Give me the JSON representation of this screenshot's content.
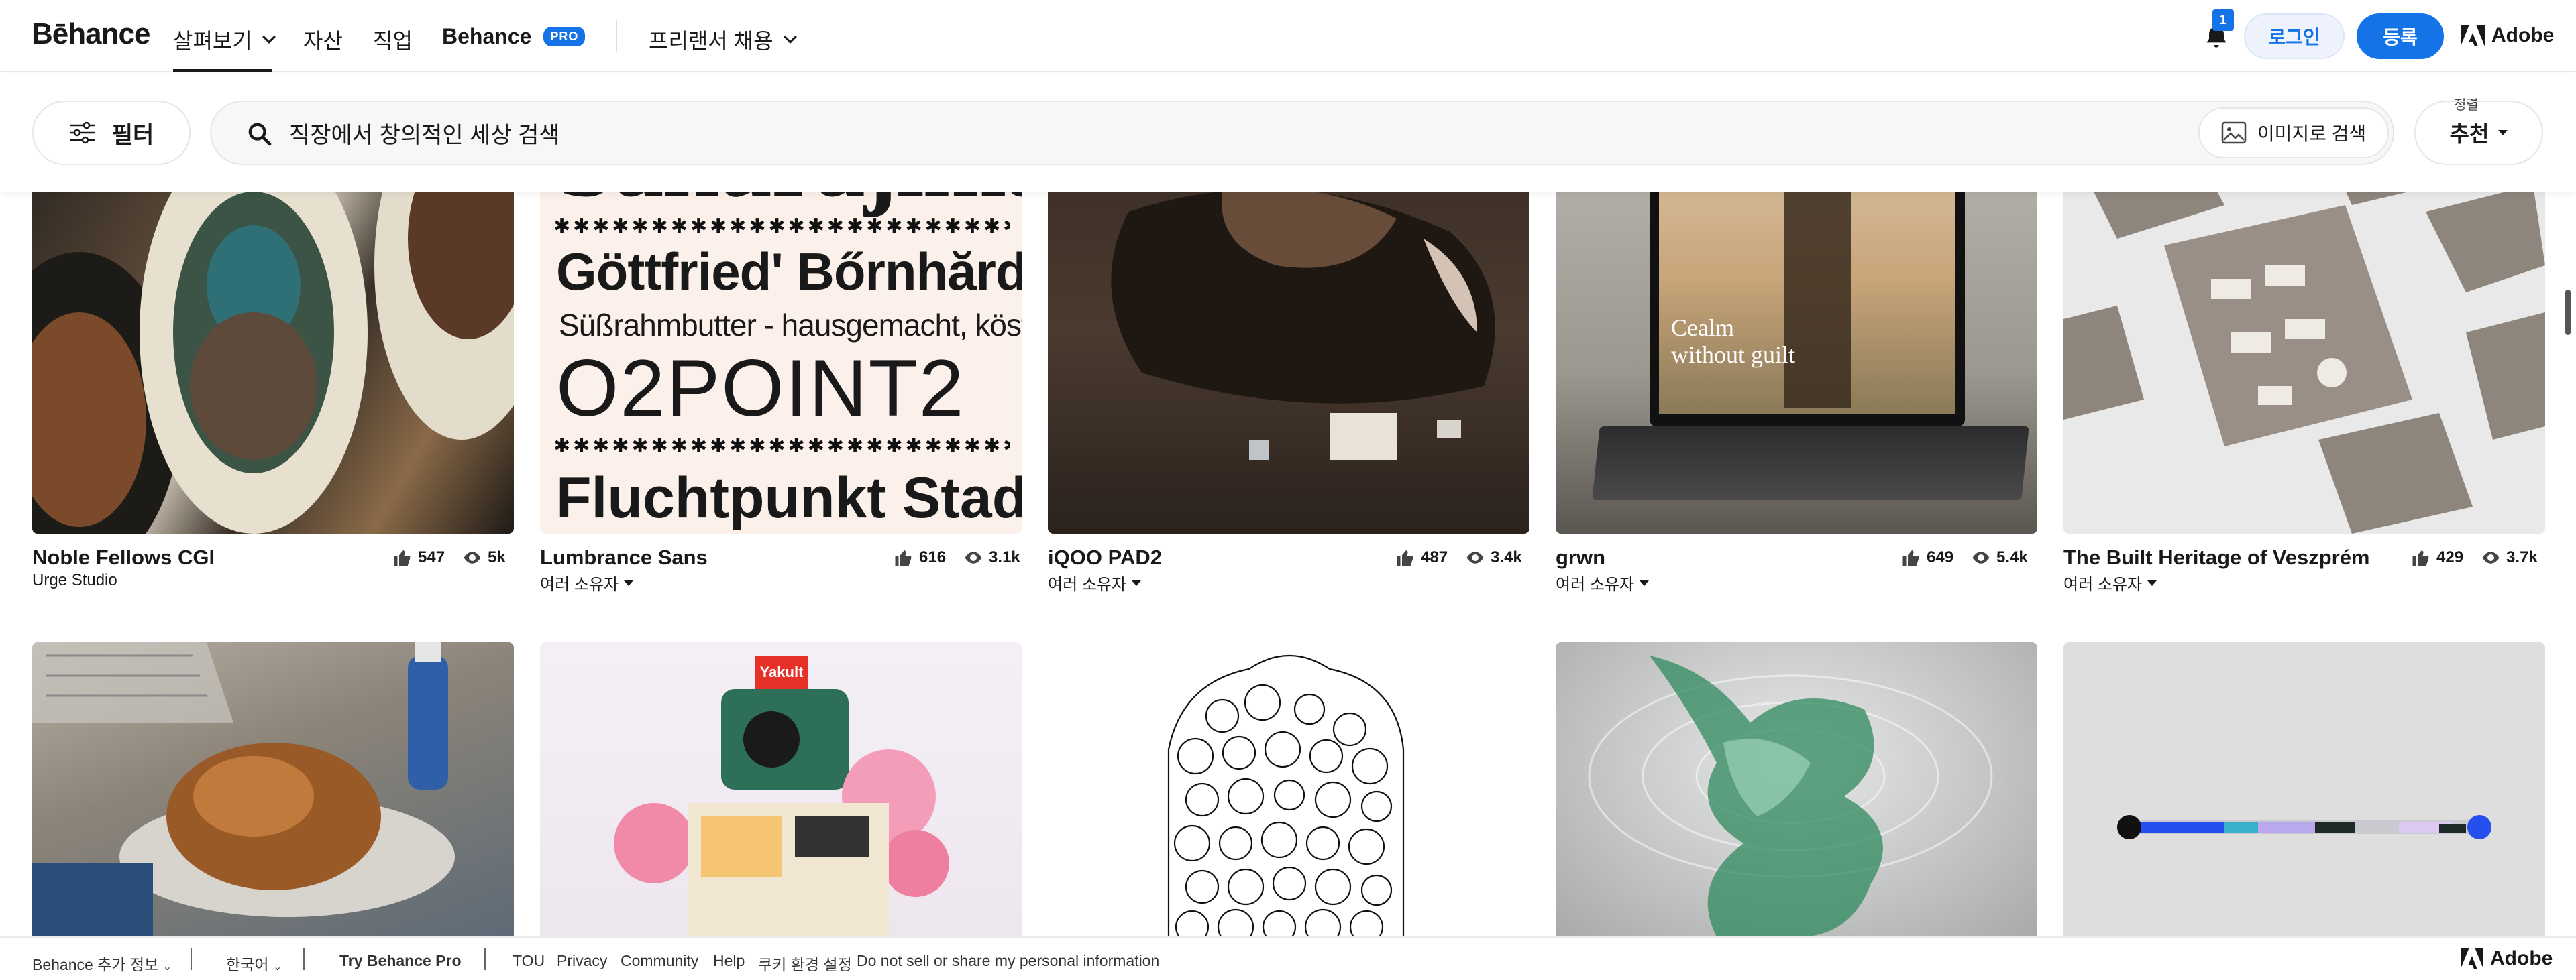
{
  "nav": {
    "logo": "Bēhance",
    "links": [
      "살펴보기",
      "자산",
      "직업"
    ],
    "behance_pro_label": "Behance",
    "pro_badge": "PRO",
    "freelance": "프리랜서 채용",
    "notification_count": "1",
    "login": "로그인",
    "signup": "등록",
    "adobe": "Adobe"
  },
  "toolbar": {
    "filter": "필터",
    "search_value": "직장에서 창의적인 세상 검색",
    "image_search": "이미지로 검색",
    "sort_label": "정렬",
    "sort_value": "추천"
  },
  "projects_row1": [
    {
      "title": "Noble Fellows CGI",
      "owner": "Urge Studio",
      "likes": "547",
      "views": "5k"
    },
    {
      "title": "Lumbrance Sans",
      "owner": "여러 소유자",
      "likes": "616",
      "views": "3.1k"
    },
    {
      "title": "iQOO PAD2",
      "owner": "여러 소유자",
      "likes": "487",
      "views": "3.4k"
    },
    {
      "title": "grwn",
      "owner": "여러 소유자",
      "likes": "649",
      "views": "5.4k"
    },
    {
      "title": "The Built Heritage of Veszprém",
      "owner": "여러 소유자",
      "likes": "429",
      "views": "3.7k"
    }
  ],
  "artwork_text": {
    "sakurajima": "Sakurajima",
    "gottfried": "Göttfried' Bőrnhărd!",
    "susrahm": "Süßrahmbutter - hausgemacht, köstlich",
    "o2point2": "O2POINT2",
    "fluchtpunkt": "Fluchtpunkt Stadt",
    "cealm": "Cealm",
    "without_guilt": "without guilt",
    "yakult": "Yakult"
  },
  "footer": {
    "more_info": "Behance 추가 정보",
    "language": "한국어",
    "try_pro": "Try Behance Pro",
    "links": [
      "TOU",
      "Privacy",
      "Community",
      "Help",
      "쿠키 환경 설정",
      "Do not sell or share my personal information"
    ],
    "adobe": "Adobe"
  },
  "colors": {
    "accent": "#1473e6",
    "text": "#191919"
  }
}
